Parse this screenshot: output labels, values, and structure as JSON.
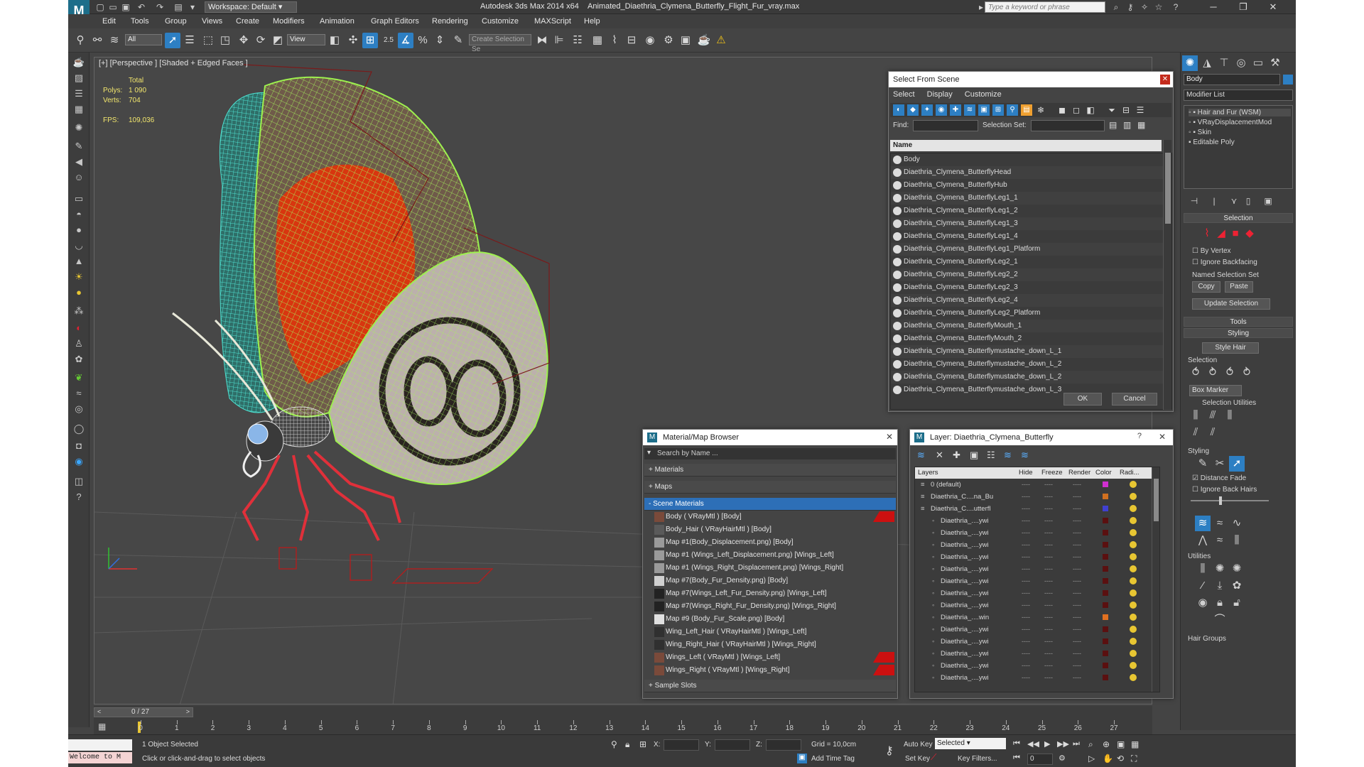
{
  "window": {
    "app_title": "Autodesk 3ds Max  2014 x64",
    "file_name": "Animated_Diaethria_Clymena_Butterfly_Flight_Fur_vray.max",
    "workspace": "Workspace: Default",
    "search_placeholder": "Type a keyword or phrase"
  },
  "menu": [
    "Edit",
    "Tools",
    "Group",
    "Views",
    "Create",
    "Modifiers",
    "Animation",
    "Graph Editors",
    "Rendering",
    "Customize",
    "MAXScript",
    "Help"
  ],
  "toolbar": {
    "filter_value": "All",
    "refcoord_value": "View",
    "selection_set_placeholder": "Create Selection Se",
    "snap_label": "2.5"
  },
  "viewport": {
    "label": "[+] [Perspective ] [Shaded + Edged Faces ]",
    "stats": {
      "total_label": "Total",
      "polys_label": "Polys:",
      "polys_value": "1 090",
      "verts_label": "Verts:",
      "verts_value": "704",
      "fps_label": "FPS:",
      "fps_value": "109,036"
    }
  },
  "select_from_scene": {
    "title": "Select From Scene",
    "tabs": [
      "Select",
      "Display",
      "Customize"
    ],
    "find_label": "Find:",
    "selection_set_label": "Selection Set:",
    "column_name": "Name",
    "items": [
      "Body",
      "Diaethria_Clymena_ButterflyHead",
      "Diaethria_Clymena_ButterflyHub",
      "Diaethria_Clymena_ButterflyLeg1_1",
      "Diaethria_Clymena_ButterflyLeg1_2",
      "Diaethria_Clymena_ButterflyLeg1_3",
      "Diaethria_Clymena_ButterflyLeg1_4",
      "Diaethria_Clymena_ButterflyLeg1_Platform",
      "Diaethria_Clymena_ButterflyLeg2_1",
      "Diaethria_Clymena_ButterflyLeg2_2",
      "Diaethria_Clymena_ButterflyLeg2_3",
      "Diaethria_Clymena_ButterflyLeg2_4",
      "Diaethria_Clymena_ButterflyLeg2_Platform",
      "Diaethria_Clymena_ButterflyMouth_1",
      "Diaethria_Clymena_ButterflyMouth_2",
      "Diaethria_Clymena_Butterflymustache_down_L_1",
      "Diaethria_Clymena_Butterflymustache_down_L_2",
      "Diaethria_Clymena_Butterflymustache_down_L_2",
      "Diaethria_Clymena_Butterflymustache_down_L_3"
    ],
    "ok_label": "OK",
    "cancel_label": "Cancel"
  },
  "material_browser": {
    "title": "Material/Map Browser",
    "search_placeholder": "Search by Name ...",
    "groups": {
      "materials": "+ Materials",
      "maps": "+ Maps",
      "scene_materials": "- Scene Materials",
      "sample_slots": "+ Sample Slots"
    },
    "items": [
      {
        "label": "Body  ( VRayMtl ) [Body]",
        "swatch": "#7a4a3a",
        "red": true
      },
      {
        "label": "Body_Hair  ( VRayHairMtl ) [Body]",
        "swatch": "#5a5a5a",
        "red": false
      },
      {
        "label": "Map #1(Body_Displacement.png) [Body]",
        "swatch": "#9a9a9a",
        "red": false
      },
      {
        "label": "Map #1 (Wings_Left_Displacement.png) [Wings_Left]",
        "swatch": "#9a9a9a",
        "red": false
      },
      {
        "label": "Map #1 (Wings_Right_Displacement.png) [Wings_Right]",
        "swatch": "#9a9a9a",
        "red": false
      },
      {
        "label": "Map #7(Body_Fur_Density.png) [Body]",
        "swatch": "#d0d0d0",
        "red": false
      },
      {
        "label": "Map #7(Wings_Left_Fur_Density.png) [Wings_Left]",
        "swatch": "#222222",
        "red": false
      },
      {
        "label": "Map #7(Wings_Right_Fur_Density.png) [Wings_Right]",
        "swatch": "#222222",
        "red": false
      },
      {
        "label": "Map #9 (Body_Fur_Scale.png) [Body]",
        "swatch": "#e0e0e0",
        "red": false
      },
      {
        "label": "Wing_Left_Hair  ( VRayHairMtl ) [Wings_Left]",
        "swatch": "#303030",
        "red": false
      },
      {
        "label": "Wing_Right_Hair  ( VRayHairMtl ) [Wings_Right]",
        "swatch": "#303030",
        "red": false
      },
      {
        "label": "Wings_Left  ( VRayMtl ) [Wings_Left]",
        "swatch": "#7a4a3a",
        "red": true
      },
      {
        "label": "Wings_Right  ( VRayMtl ) [Wings_Right]",
        "swatch": "#7a4a3a",
        "red": true
      }
    ]
  },
  "layer_manager": {
    "title": "Layer: Diaethria_Clymena_Butterfly",
    "columns": [
      "Layers",
      "Hide",
      "Freeze",
      "Render",
      "Color",
      "Radi..."
    ],
    "rows": [
      {
        "name": "0 (default)",
        "color": "#d02fd0",
        "indent": 0
      },
      {
        "name": "Diaethria_C....na_Bu",
        "color": "#d07020",
        "indent": 0
      },
      {
        "name": "Diaethria_C....utterfl",
        "color": "#4040d0",
        "indent": 0
      },
      {
        "name": "Diaethria_....ywi",
        "color": "#5a1010",
        "indent": 1
      },
      {
        "name": "Diaethria_....ywi",
        "color": "#5a1010",
        "indent": 1
      },
      {
        "name": "Diaethria_....ywi",
        "color": "#5a1010",
        "indent": 1
      },
      {
        "name": "Diaethria_....ywi",
        "color": "#5a1010",
        "indent": 1
      },
      {
        "name": "Diaethria_....ywi",
        "color": "#5a1010",
        "indent": 1
      },
      {
        "name": "Diaethria_....ywi",
        "color": "#5a1010",
        "indent": 1
      },
      {
        "name": "Diaethria_....ywi",
        "color": "#5a1010",
        "indent": 1
      },
      {
        "name": "Diaethria_....ywi",
        "color": "#5a1010",
        "indent": 1
      },
      {
        "name": "Diaethria_....win",
        "color": "#e07020",
        "indent": 1
      },
      {
        "name": "Diaethria_....ywi",
        "color": "#5a1010",
        "indent": 1
      },
      {
        "name": "Diaethria_....ywi",
        "color": "#5a1010",
        "indent": 1
      },
      {
        "name": "Diaethria_....ywi",
        "color": "#5a1010",
        "indent": 1
      },
      {
        "name": "Diaethria_....ywi",
        "color": "#5a1010",
        "indent": 1
      },
      {
        "name": "Diaethria_....ywi",
        "color": "#5a1010",
        "indent": 1
      }
    ]
  },
  "command_panel": {
    "object_name": "Body",
    "modifier_list": "Modifier List",
    "stack": [
      "Hair and Fur (WSM)",
      "VRayDisplacementMod",
      "Skin",
      "Editable Poly"
    ],
    "selection_header": "Selection",
    "by_vertex": "By Vertex",
    "ignore_backfacing": "Ignore Backfacing",
    "named_selection_set": "Named Selection Set",
    "copy": "Copy",
    "paste": "Paste",
    "update_selection": "Update Selection",
    "tools_header": "Tools",
    "styling_header": "Styling",
    "style_hair": "Style Hair",
    "selection_sub": "Selection",
    "box_marker": "Box Marker",
    "selection_utilities": "Selection Utilities",
    "styling_sub": "Styling",
    "distance_fade": "Distance Fade",
    "ignore_back_hairs": "Ignore Back Hairs",
    "utilities_sub": "Utilities",
    "hair_groups": "Hair Groups"
  },
  "timeline": {
    "frame_display": "0 / 27",
    "ticks": [
      "0",
      "1",
      "2",
      "3",
      "4",
      "5",
      "6",
      "7",
      "8",
      "9",
      "10",
      "11",
      "12",
      "13",
      "14",
      "15",
      "16",
      "17",
      "18",
      "19",
      "20",
      "21",
      "22",
      "23",
      "24",
      "25",
      "26",
      "27"
    ]
  },
  "status": {
    "listener": "Welcome to M",
    "selected": "1 Object Selected",
    "prompt": "Click or click-and-drag to select objects",
    "x_label": "X:",
    "y_label": "Y:",
    "z_label": "Z:",
    "grid": "Grid = 10,0cm",
    "add_time_tag": "Add Time Tag",
    "auto_key": "Auto Key",
    "set_key": "Set Key",
    "selected_dropdown": "Selected",
    "key_filters": "Key Filters...",
    "frame_value": "0"
  },
  "colors": {
    "accent": "#2d7fc3",
    "wing_green": "#8fe84a",
    "wing_cyan": "#46d6c8",
    "wing_red": "#e03c10",
    "legs_red": "#d02020"
  }
}
